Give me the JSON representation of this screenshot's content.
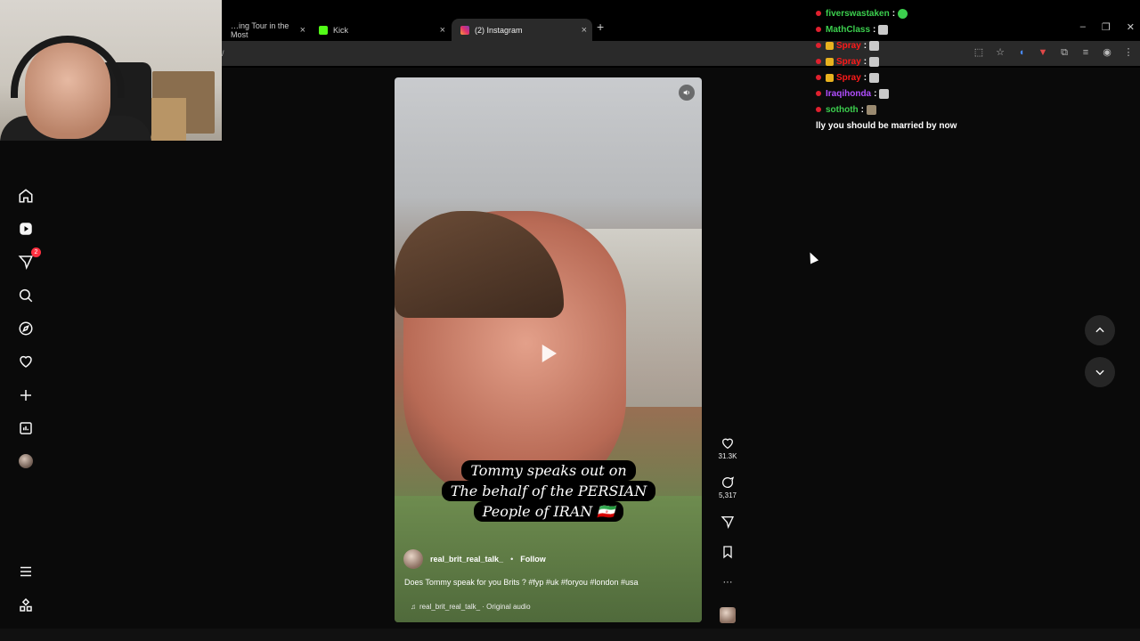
{
  "browser": {
    "tabs": [
      {
        "label": "…ing Tour in the Most",
        "favicon_color": "#e0e0e0",
        "active": false
      },
      {
        "label": "Kick",
        "favicon_color": "#53fc18",
        "active": false
      },
      {
        "label": "(2) Instagram",
        "favicon_color": "#e1306c",
        "active": true
      }
    ],
    "tab_close_glyph": "×",
    "new_tab_glyph": "+",
    "address_text": "/",
    "window_controls": [
      "–",
      "❐",
      "✕"
    ]
  },
  "sidebar": {
    "items": [
      {
        "name": "home-icon"
      },
      {
        "name": "reels-icon"
      },
      {
        "name": "messages-icon",
        "badge": "2"
      },
      {
        "name": "search-icon"
      },
      {
        "name": "explore-icon"
      },
      {
        "name": "notifications-icon"
      },
      {
        "name": "create-icon"
      },
      {
        "name": "dashboard-icon"
      },
      {
        "name": "profile-avatar"
      }
    ],
    "more_icon": "menu-icon",
    "also_from_meta_icon": "apps-icon"
  },
  "chat": {
    "messages": [
      {
        "user": "fiverswastaken",
        "color": "#3ccf4e",
        "badge": false,
        "text": ":",
        "emote": "green"
      },
      {
        "user": "MathClass",
        "color": "#3ccf4e",
        "badge": false,
        "text": ":",
        "emote": "gray"
      },
      {
        "user": "Spray",
        "color": "#ff1a1a",
        "badge": true,
        "text": ":",
        "emote": "gray"
      },
      {
        "user": "Spray",
        "color": "#ff1a1a",
        "badge": true,
        "text": ":",
        "emote": "gray"
      },
      {
        "user": "Spray",
        "color": "#ff1a1a",
        "badge": true,
        "text": ":",
        "emote": "gray"
      },
      {
        "user": "Iraqihonda",
        "color": "#b14eff",
        "badge": false,
        "text": ":",
        "emote": "gray"
      },
      {
        "user": "sothoth",
        "color": "#3ccf4e",
        "badge": false,
        "text": ":",
        "emote": "gray"
      }
    ],
    "trailing_message": "lly you should be married by now"
  },
  "reel": {
    "caption_lines": [
      "Tommy speaks out on",
      "The behalf of the PERSIAN",
      "People of IRAN 🇮🇷"
    ],
    "author": "real_brit_real_talk_",
    "separator": "•",
    "follow_label": "Follow",
    "description": "Does Tommy speak for you Brits ? #fyp #uk #foryou #london #usa",
    "audio": "real_brit_real_talk_ · Original audio",
    "likes": "31.3K",
    "comments": "5,317",
    "more_glyph": "···"
  },
  "colors": {
    "accent_red": "#ff3040",
    "panel_bg": "#262626"
  }
}
